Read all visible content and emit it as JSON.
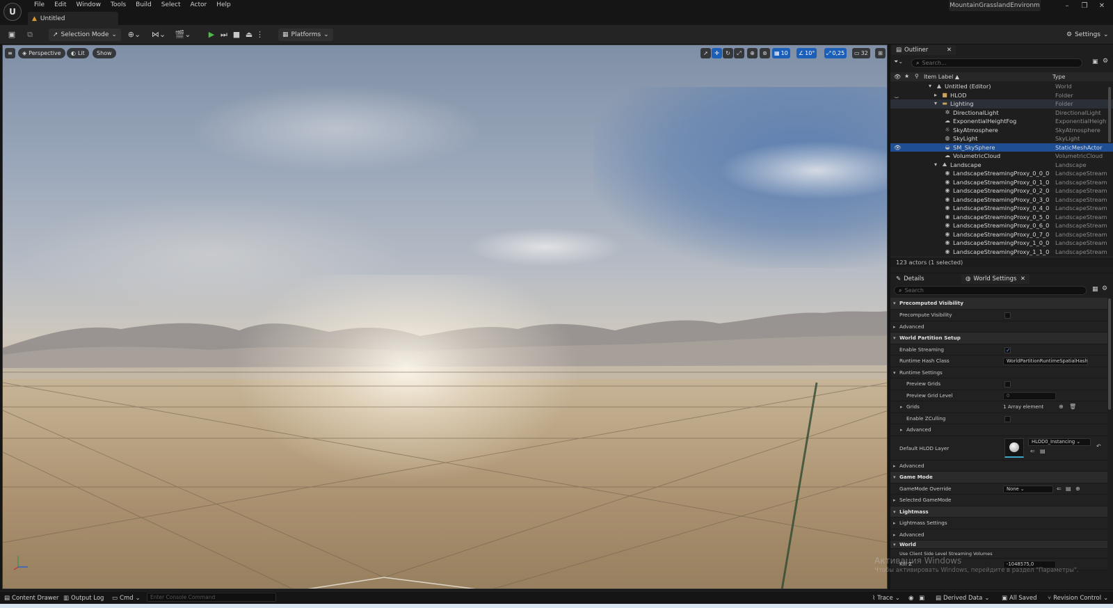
{
  "app": {
    "logo_text": "U",
    "menus": [
      "File",
      "Edit",
      "Window",
      "Tools",
      "Build",
      "Select",
      "Actor",
      "Help"
    ],
    "document_tab": "Untitled",
    "project_name": "MountainGrasslandEnvironm",
    "window_controls": {
      "minimize": "–",
      "maximize": "❐",
      "close": "✕"
    }
  },
  "toolbar": {
    "selection_mode": "Selection Mode",
    "platforms": "Platforms",
    "settings": "Settings"
  },
  "viewport": {
    "perspective": "Perspective",
    "lit": "Lit",
    "show": "Show",
    "grid_snap": "10",
    "rotation_snap": "10°",
    "scale_snap": "0,25",
    "camera_speed": "32"
  },
  "outliner": {
    "tab": "Outliner",
    "search_placeholder": "Search...",
    "col_label": "Item Label ▲",
    "col_type": "Type",
    "rows": [
      {
        "label": "Untitled (Editor)",
        "type": "World"
      },
      {
        "label": "HLOD",
        "type": "Folder"
      },
      {
        "label": "Lighting",
        "type": "Folder"
      },
      {
        "label": "DirectionalLight",
        "type": "DirectionalLight"
      },
      {
        "label": "ExponentialHeightFog",
        "type": "ExponentialHeightF"
      },
      {
        "label": "SkyAtmosphere",
        "type": "SkyAtmosphere"
      },
      {
        "label": "SkyLight",
        "type": "SkyLight"
      },
      {
        "label": "SM_SkySphere",
        "type": "StaticMeshActor"
      },
      {
        "label": "VolumetricCloud",
        "type": "VolumetricCloud"
      },
      {
        "label": "Landscape",
        "type": "Landscape"
      },
      {
        "label": "LandscapeStreamingProxy_0_0_0",
        "type": "LandscapeStreamin"
      },
      {
        "label": "LandscapeStreamingProxy_0_1_0",
        "type": "LandscapeStreamin"
      },
      {
        "label": "LandscapeStreamingProxy_0_2_0",
        "type": "LandscapeStreamin"
      },
      {
        "label": "LandscapeStreamingProxy_0_3_0",
        "type": "LandscapeStreamin"
      },
      {
        "label": "LandscapeStreamingProxy_0_4_0",
        "type": "LandscapeStreamin"
      },
      {
        "label": "LandscapeStreamingProxy_0_5_0",
        "type": "LandscapeStreamin"
      },
      {
        "label": "LandscapeStreamingProxy_0_6_0",
        "type": "LandscapeStreamin"
      },
      {
        "label": "LandscapeStreamingProxy_0_7_0",
        "type": "LandscapeStreamin"
      },
      {
        "label": "LandscapeStreamingProxy_1_0_0",
        "type": "LandscapeStreamin"
      },
      {
        "label": "LandscapeStreamingProxy_1_1_0",
        "type": "LandscapeStreamin"
      }
    ],
    "footer": "123 actors (1 selected)"
  },
  "details": {
    "tab_details": "Details",
    "tab_world_settings": "World Settings",
    "search_placeholder": "Search",
    "precomputed_visibility": "Precomputed Visibility",
    "precompute_visibility": "Precompute Visibility",
    "advanced": "Advanced",
    "world_partition_setup": "World Partition Setup",
    "enable_streaming": "Enable Streaming",
    "runtime_hash_class": "Runtime Hash Class",
    "runtime_hash_value": "WorldPartitionRuntimeSpatialHash",
    "runtime_settings": "Runtime Settings",
    "preview_grids": "Preview Grids",
    "preview_grid_level": "Preview Grid Level",
    "preview_grid_level_value": "0",
    "grids": "Grids",
    "grids_value": "1 Array element",
    "enable_zculling": "Enable ZCulling",
    "default_hlod_layer": "Default HLOD Layer",
    "hlod_value": "HLOD0_Instancing",
    "game_mode": "Game Mode",
    "gamemode_override": "GameMode Override",
    "gamemode_value": "None",
    "selected_gamemode": "Selected GameMode",
    "lightmass": "Lightmass",
    "lightmass_settings": "Lightmass Settings",
    "world": "World",
    "use_client_side": "Use Client Side Level Streaming Volumes",
    "kill_z": "Kill Z",
    "kill_z_value": "-1048575,0"
  },
  "watermark": {
    "line1": "Активация Windows",
    "line2": "Чтобы активировать Windows, перейдите в раздел \"Параметры\"."
  },
  "statusbar": {
    "content_drawer": "Content Drawer",
    "output_log": "Output Log",
    "cmd": "Cmd",
    "console_placeholder": "Enter Console Command",
    "trace": "Trace",
    "derived_data": "Derived Data",
    "all_saved": "All Saved",
    "revision_control": "Revision Control"
  }
}
